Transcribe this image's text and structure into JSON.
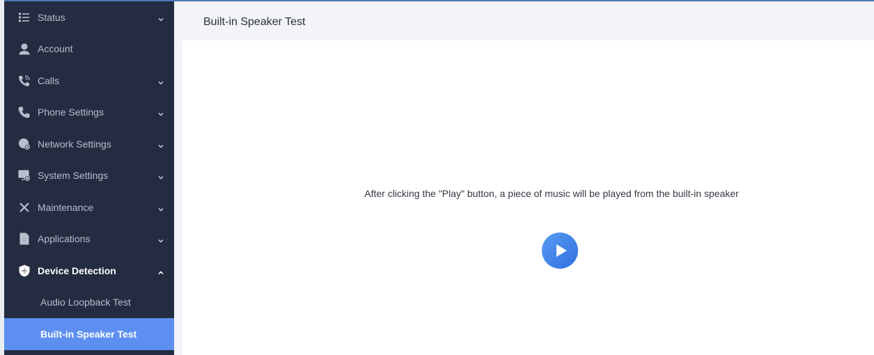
{
  "header": {
    "title": "Built-in Speaker Test"
  },
  "main": {
    "message": "After clicking the \"Play\" button, a piece of music will be played from the built-in speaker",
    "play_icon": "play-icon"
  },
  "sidebar": {
    "items": [
      {
        "label": "Status",
        "icon": "list-icon",
        "expandable": true
      },
      {
        "label": "Account",
        "icon": "user-icon",
        "expandable": false
      },
      {
        "label": "Calls",
        "icon": "phone-ring-icon",
        "expandable": true
      },
      {
        "label": "Phone Settings",
        "icon": "phone-icon",
        "expandable": true
      },
      {
        "label": "Network Settings",
        "icon": "globe-gear-icon",
        "expandable": true
      },
      {
        "label": "System Settings",
        "icon": "screen-gear-icon",
        "expandable": true
      },
      {
        "label": "Maintenance",
        "icon": "tools-icon",
        "expandable": true
      },
      {
        "label": "Applications",
        "icon": "document-icon",
        "expandable": true
      },
      {
        "label": "Device Detection",
        "icon": "shield-plus-icon",
        "expandable": true,
        "open": true
      }
    ],
    "subitems": [
      {
        "label": "Audio Loopback Test"
      },
      {
        "label": "Built-in Speaker Test",
        "active": true
      }
    ]
  },
  "colors": {
    "sidebar_bg": "#232c40",
    "active_item": "#5c8ff0",
    "play_button": "#3a7ce6"
  }
}
